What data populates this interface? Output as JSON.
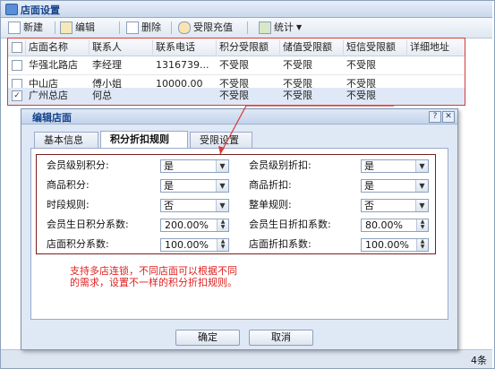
{
  "window": {
    "title": "店面设置"
  },
  "toolbar": {
    "new": "新建",
    "edit": "编辑",
    "delete": "删除",
    "limit_recharge": "受限充值",
    "stats": "统计"
  },
  "grid": {
    "columns": [
      "店面名称",
      "联系人",
      "联系电话",
      "积分受限额",
      "储值受限额",
      "短信受限额",
      "详细地址"
    ],
    "rows": [
      {
        "checked": false,
        "cells": [
          "华强北路店",
          "李经理",
          "1316739...",
          "不受限",
          "不受限",
          "不受限",
          ""
        ]
      },
      {
        "checked": false,
        "cells": [
          "中山店",
          "傅小姐",
          "10000.00",
          "不受限",
          "不受限",
          "不受限",
          ""
        ]
      },
      {
        "checked": true,
        "cells": [
          "广州总店",
          "何总",
          "",
          "不受限",
          "不受限",
          "不受限",
          ""
        ]
      }
    ]
  },
  "statusbar": {
    "count_text": "4条"
  },
  "dialog": {
    "title": "编辑店面",
    "help_btn": "?",
    "close_btn": "✕",
    "tabs": [
      "基本信息",
      "积分折扣规则",
      "受限设置"
    ],
    "active_tab": 1,
    "fields": {
      "member_level_points": {
        "label": "会员级别积分:",
        "value": "是"
      },
      "member_level_discount": {
        "label": "会员级别折扣:",
        "value": "是"
      },
      "product_points": {
        "label": "商品积分:",
        "value": "是"
      },
      "product_discount": {
        "label": "商品折扣:",
        "value": "是"
      },
      "period_rule": {
        "label": "时段规则:",
        "value": "否"
      },
      "order_rule": {
        "label": "整单规则:",
        "value": "否"
      },
      "birthday_points": {
        "label": "会员生日积分系数:",
        "value": "200.00%"
      },
      "birthday_discount": {
        "label": "会员生日折扣系数:",
        "value": "80.00%"
      },
      "store_points": {
        "label": "店面积分系数:",
        "value": "100.00%"
      },
      "store_discount": {
        "label": "店面折扣系数:",
        "value": "100.00%"
      }
    },
    "note_line1": "支持多店连锁，不同店面可以根据不同",
    "note_line2": "的需求，设置不一样的积分折扣规则。",
    "ok": "确定",
    "cancel": "取消"
  },
  "colors": {
    "annotation": "#e02020",
    "frame_red": "#d63a3a",
    "title_blue": "#15428b"
  }
}
